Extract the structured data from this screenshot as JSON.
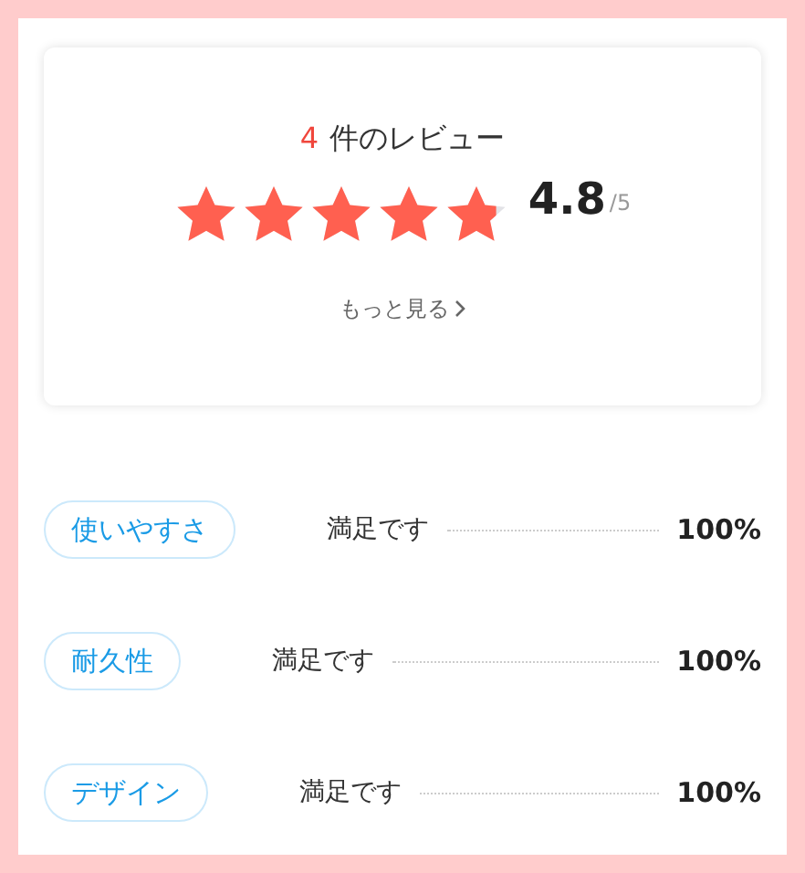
{
  "summary": {
    "count": "4",
    "count_label": "件のレビュー",
    "stars": 4.8,
    "score": "4.8",
    "score_max": "/5",
    "more_link": "もっと見る"
  },
  "aspects": [
    {
      "tag": "使いやすさ",
      "label": "満足です",
      "percent": "100%"
    },
    {
      "tag": "耐久性",
      "label": "満足です",
      "percent": "100%"
    },
    {
      "tag": "デザイン",
      "label": "満足です",
      "percent": "100%"
    }
  ]
}
